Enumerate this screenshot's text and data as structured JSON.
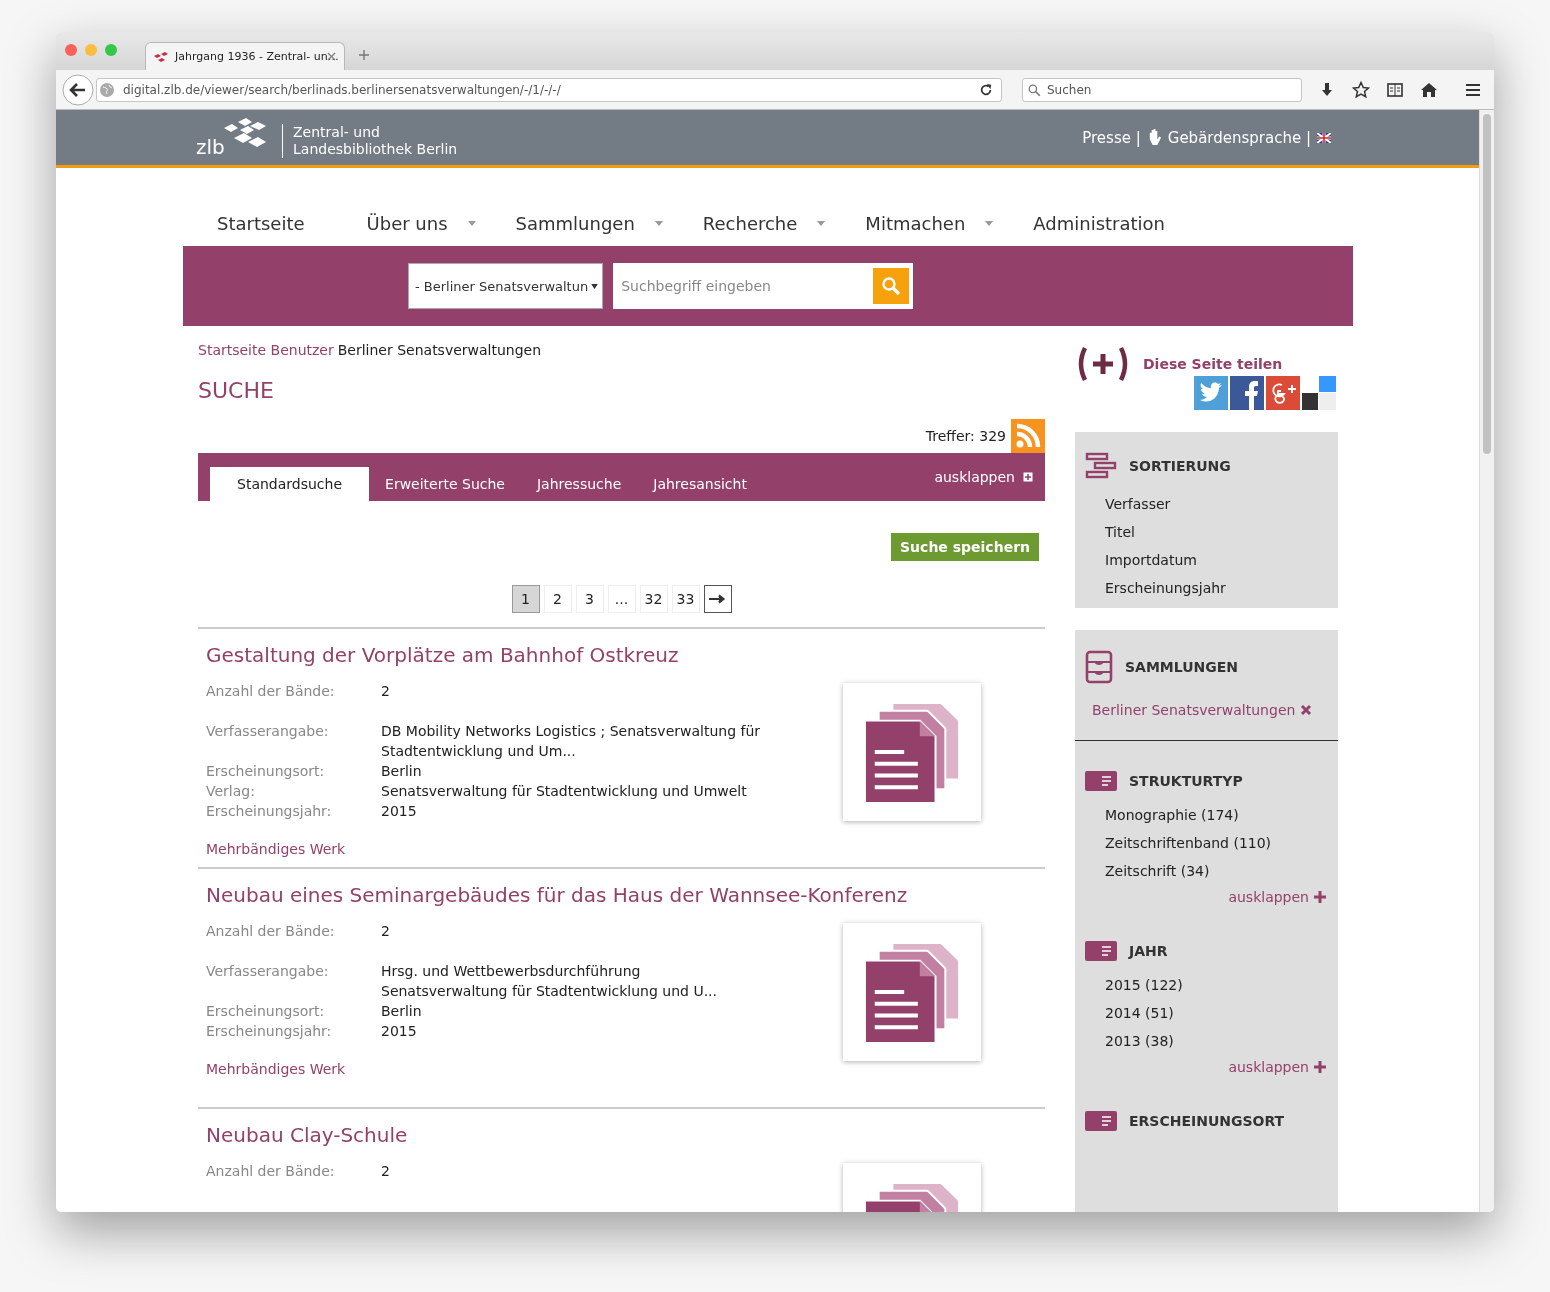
{
  "browser": {
    "tab_title": "Jahrgang 1936 - Zentral- un…",
    "url": "digital.zlb.de/viewer/search/berlinads.berlinersenatsverwaltungen/-/1/-/-/",
    "search_placeholder": "Suchen"
  },
  "header": {
    "logo_text": "zlb",
    "name_lines": [
      "Zentral- und",
      "Landesbibliothek Berlin"
    ],
    "links": [
      {
        "kind": "text",
        "label": "Presse |"
      },
      {
        "kind": "sign",
        "label": "Gebärdensprache |"
      },
      {
        "kind": "flag"
      }
    ]
  },
  "nav": [
    {
      "label": "Startseite",
      "dropdown": false
    },
    {
      "label": "Über uns",
      "dropdown": true
    },
    {
      "label": "Sammlungen",
      "dropdown": true
    },
    {
      "label": "Recherche",
      "dropdown": true
    },
    {
      "label": "Mitmachen",
      "dropdown": true
    },
    {
      "label": "Administration",
      "dropdown": false
    }
  ],
  "search": {
    "select_value": "- Berliner Senatsverwaltun",
    "placeholder": "Suchbegriff eingeben"
  },
  "breadcrumb": [
    {
      "label": "Startseite Benutzer",
      "link": true
    },
    {
      "label": "Berliner Senatsverwaltungen",
      "link": false
    }
  ],
  "heading": "SUCHE",
  "hits": "Treffer: 329",
  "tabs": [
    {
      "label": "Standardsuche",
      "selected": true
    },
    {
      "label": "Erweiterte Suche",
      "selected": false
    },
    {
      "label": "Jahressuche",
      "selected": false
    },
    {
      "label": "Jahresansicht",
      "selected": false
    }
  ],
  "tabs_expand": "ausklappen",
  "save_button": "Suche speichern",
  "pages": [
    {
      "label": "1",
      "selected": true
    },
    {
      "label": "2",
      "selected": false
    },
    {
      "label": "3",
      "selected": false
    },
    {
      "label": "...",
      "selected": false
    },
    {
      "label": "32",
      "selected": false
    },
    {
      "label": "33",
      "selected": false
    }
  ],
  "results": [
    {
      "title": "Gestaltung der Vorplätze am Bahnhof Ostkreuz",
      "groups": [
        [
          {
            "label": "Anzahl der Bände:",
            "value": "2"
          }
        ],
        [
          {
            "label": "Verfasserangabe:",
            "value": "DB Mobility Networks Logistics ; Senatsverwaltung für Stadtentwicklung und Um..."
          },
          {
            "label": "Erscheinungsort:",
            "value": "Berlin"
          },
          {
            "label": "Verlag:",
            "value": "Senatsverwaltung für Stadtentwicklung und Umwelt"
          },
          {
            "label": "Erscheinungsjahr:",
            "value": "2015"
          }
        ]
      ],
      "note": "Mehrbändiges Werk"
    },
    {
      "title": "Neubau eines Seminargebäudes für das Haus der Wannsee-Konferenz",
      "groups": [
        [
          {
            "label": "Anzahl der Bände:",
            "value": "2"
          }
        ],
        [
          {
            "label": "Verfasserangabe:",
            "value": "Hrsg. und Wettbewerbsdurchführung Senatsverwaltung für Stadtentwicklung und U..."
          },
          {
            "label": "Erscheinungsort:",
            "value": "Berlin"
          },
          {
            "label": "Erscheinungsjahr:",
            "value": "2015"
          }
        ]
      ],
      "note": "Mehrbändiges Werk"
    },
    {
      "title": "Neubau Clay-Schule",
      "groups": [
        [
          {
            "label": "Anzahl der Bände:",
            "value": "2"
          }
        ]
      ]
    }
  ],
  "sidebar": {
    "share_label": "Diese Seite teilen",
    "sorting": {
      "title": "SORTIERUNG",
      "items": [
        "Verfasser",
        "Titel",
        "Importdatum",
        "Erscheinungsjahr"
      ]
    },
    "collections": {
      "title": "SAMMLUNGEN",
      "active": "Berliner Senatsverwaltungen"
    },
    "facets": [
      {
        "title": "STRUKTURTYP",
        "items": [
          "Monographie (174)",
          "Zeitschriftenband (110)",
          "Zeitschrift (34)"
        ],
        "expand": "ausklappen"
      },
      {
        "title": "JAHR",
        "items": [
          "2015 (122)",
          "2014 (51)",
          "2013 (38)"
        ],
        "expand": "ausklappen"
      },
      {
        "title": "ERSCHEINUNGSORT"
      }
    ]
  }
}
